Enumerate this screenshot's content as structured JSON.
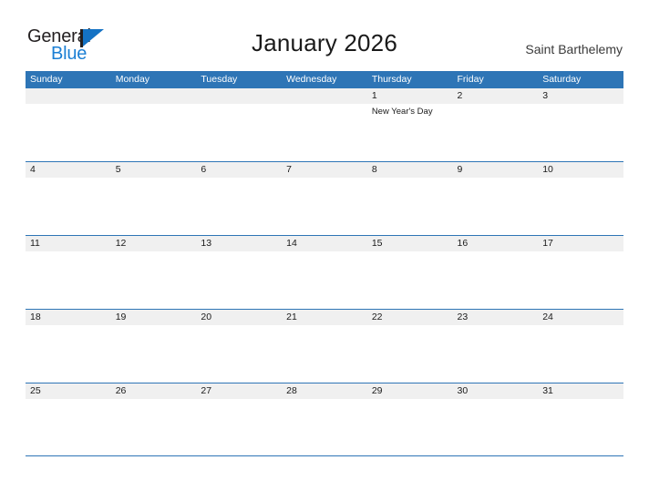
{
  "brand": {
    "name_part1": "General",
    "name_part2": "Blue",
    "flag_color": "#1472c4",
    "text_color_1": "#231f20",
    "text_color_2": "#1b7fd4"
  },
  "header": {
    "title": "January 2026",
    "location": "Saint Barthelemy"
  },
  "calendar": {
    "header_color": "#2e75b6",
    "band_color": "#f0f0f0",
    "weekdays": [
      "Sunday",
      "Monday",
      "Tuesday",
      "Wednesday",
      "Thursday",
      "Friday",
      "Saturday"
    ],
    "weeks": [
      {
        "days": [
          {
            "date": "",
            "event": ""
          },
          {
            "date": "",
            "event": ""
          },
          {
            "date": "",
            "event": ""
          },
          {
            "date": "",
            "event": ""
          },
          {
            "date": "1",
            "event": "New Year's Day"
          },
          {
            "date": "2",
            "event": ""
          },
          {
            "date": "3",
            "event": ""
          }
        ]
      },
      {
        "days": [
          {
            "date": "4",
            "event": ""
          },
          {
            "date": "5",
            "event": ""
          },
          {
            "date": "6",
            "event": ""
          },
          {
            "date": "7",
            "event": ""
          },
          {
            "date": "8",
            "event": ""
          },
          {
            "date": "9",
            "event": ""
          },
          {
            "date": "10",
            "event": ""
          }
        ]
      },
      {
        "days": [
          {
            "date": "11",
            "event": ""
          },
          {
            "date": "12",
            "event": ""
          },
          {
            "date": "13",
            "event": ""
          },
          {
            "date": "14",
            "event": ""
          },
          {
            "date": "15",
            "event": ""
          },
          {
            "date": "16",
            "event": ""
          },
          {
            "date": "17",
            "event": ""
          }
        ]
      },
      {
        "days": [
          {
            "date": "18",
            "event": ""
          },
          {
            "date": "19",
            "event": ""
          },
          {
            "date": "20",
            "event": ""
          },
          {
            "date": "21",
            "event": ""
          },
          {
            "date": "22",
            "event": ""
          },
          {
            "date": "23",
            "event": ""
          },
          {
            "date": "24",
            "event": ""
          }
        ]
      },
      {
        "days": [
          {
            "date": "25",
            "event": ""
          },
          {
            "date": "26",
            "event": ""
          },
          {
            "date": "27",
            "event": ""
          },
          {
            "date": "28",
            "event": ""
          },
          {
            "date": "29",
            "event": ""
          },
          {
            "date": "30",
            "event": ""
          },
          {
            "date": "31",
            "event": ""
          }
        ]
      }
    ]
  }
}
